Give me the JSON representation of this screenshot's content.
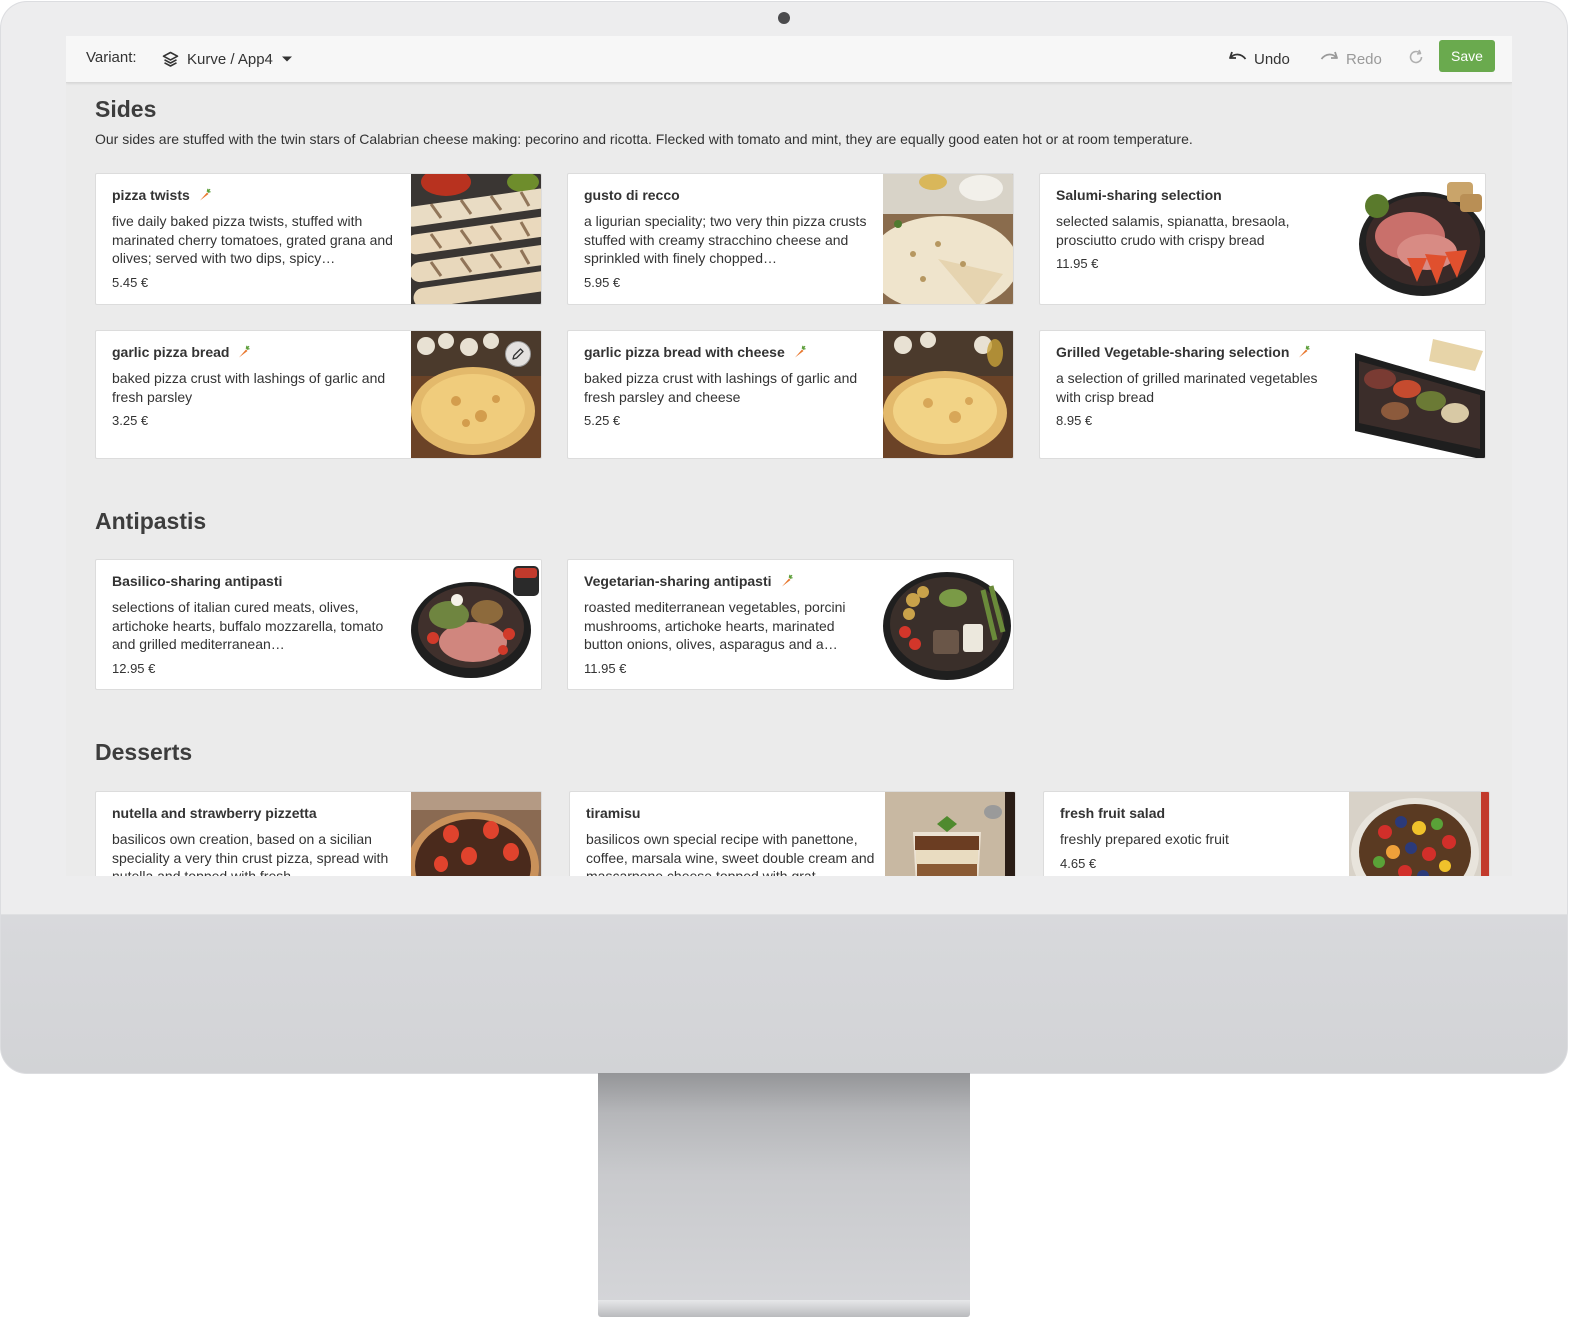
{
  "toolbar": {
    "variant_label": "Variant:",
    "variant_value": "Kurve / App4",
    "undo_label": "Undo",
    "redo_label": "Redo",
    "save_label": "Save"
  },
  "sections": [
    {
      "title": "Sides",
      "description": "Our sides are stuffed with the twin stars of Calabrian cheese making: pecorino and ricotta. Flecked with tomato and mint, they are equally good eaten hot or at room temperature.",
      "items": [
        {
          "name": "pizza twists",
          "vegetarian": true,
          "description": "five daily baked pizza twists, stuffed with marinated cherry tomatoes, grated grana and olives; served with two dips, spicy…",
          "price": "5.45 €"
        },
        {
          "name": "gusto di recco",
          "vegetarian": false,
          "description": "a ligurian speciality; two very thin pizza crusts stuffed with creamy stracchino cheese and sprinkled with finely chopped…",
          "price": "5.95 €"
        },
        {
          "name": "Salumi-sharing selection",
          "vegetarian": false,
          "description": "selected salamis, spianatta, bresaola, prosciutto crudo with crispy bread",
          "price": "11.95 €"
        },
        {
          "name": "garlic pizza bread",
          "vegetarian": true,
          "description": "baked pizza crust with lashings of garlic and fresh parsley",
          "price": "3.25 €"
        },
        {
          "name": "garlic pizza bread with cheese",
          "vegetarian": true,
          "description": "baked pizza crust with lashings of garlic and fresh parsley and cheese",
          "price": "5.25 €"
        },
        {
          "name": "Grilled Vegetable-sharing selection",
          "vegetarian": true,
          "description": "a selection of grilled marinated vegetables with crisp bread",
          "price": "8.95 €"
        }
      ]
    },
    {
      "title": "Antipastis",
      "items": [
        {
          "name": "Basilico-sharing antipasti",
          "vegetarian": false,
          "description": "selections of italian cured meats, olives, artichoke hearts, buffalo mozzarella, tomato and grilled mediterranean…",
          "price": "12.95 €"
        },
        {
          "name": "Vegetarian-sharing antipasti",
          "vegetarian": true,
          "description": "roasted mediterranean vegetables, porcini mushrooms, artichoke hearts, marinated button onions, olives, asparagus and a…",
          "price": "11.95 €"
        }
      ]
    },
    {
      "title": "Desserts",
      "items": [
        {
          "name": "nutella and strawberry pizzetta",
          "vegetarian": false,
          "description": "basilicos own creation, based on a sicilian speciality a very thin crust pizza, spread with nutella and topped with fresh",
          "price": ""
        },
        {
          "name": "tiramisu",
          "vegetarian": false,
          "description": "basilicos own special recipe with panettone, coffee, marsala wine, sweet double cream and mascarpone cheese topped with grat",
          "price": ""
        },
        {
          "name": "fresh fruit salad",
          "vegetarian": false,
          "description": "freshly prepared exotic fruit",
          "price": "4.65 €"
        }
      ]
    }
  ],
  "colors": {
    "save_button": "#6aaa4e",
    "screen_background": "#ebebeb",
    "card_background": "#ffffff",
    "vegetarian_icon": "#e8772e"
  },
  "icons": {
    "variant": "layers-icon",
    "variant_dropdown": "caret-down-icon",
    "undo": "undo-icon",
    "redo": "redo-icon",
    "refresh": "refresh-icon",
    "vegetarian": "carrot-icon",
    "image_edit": "pencil-icon"
  }
}
